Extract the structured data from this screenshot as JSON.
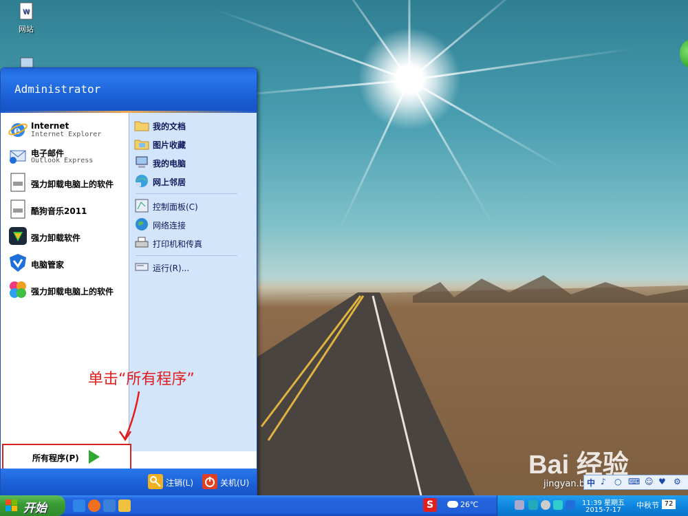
{
  "desktop": {
    "icons": [
      {
        "label": "网站",
        "icon": "html-file-icon"
      },
      {
        "label": "",
        "icon": "computer-icon"
      }
    ]
  },
  "start_menu": {
    "user": "Administrator",
    "pinned": [
      {
        "title": "Internet",
        "subtitle": "Internet Explorer",
        "icon": "ie-icon"
      },
      {
        "title": "电子邮件",
        "subtitle": "Outlook Express",
        "icon": "outlook-icon"
      }
    ],
    "recent": [
      {
        "label": "强力卸载电脑上的软件",
        "icon": "document-icon"
      },
      {
        "label": "酷狗音乐2011",
        "icon": "document-icon"
      },
      {
        "label": "强力卸载软件",
        "icon": "uninstaller-icon"
      },
      {
        "label": "电脑管家",
        "icon": "shield-icon"
      },
      {
        "label": "强力卸载电脑上的软件",
        "icon": "flower-icon"
      }
    ],
    "places": [
      {
        "label": "我的文档",
        "icon": "folder-icon"
      },
      {
        "label": "图片收藏",
        "icon": "pictures-folder-icon"
      },
      {
        "label": "我的电脑",
        "icon": "computer-icon"
      },
      {
        "label": "网上邻居",
        "icon": "network-icon"
      }
    ],
    "system": [
      {
        "label": "控制面板(C)",
        "icon": "control-panel-icon"
      },
      {
        "label": "网络连接",
        "icon": "network-globe-icon"
      },
      {
        "label": "打印机和传真",
        "icon": "printer-icon"
      }
    ],
    "run": {
      "label": "运行(R)...",
      "icon": "run-icon"
    },
    "all_programs": "所有程序(P)",
    "logoff": "注销(L)",
    "shutdown": "关机(U)"
  },
  "annotation": "单击“所有程序”",
  "taskbar": {
    "start_label": "开始",
    "weather": "26℃",
    "time": "11:39 星期五",
    "date": "2015-7-17",
    "festival": "中秋节",
    "festival_count": "72"
  },
  "ime_bar": [
    "中",
    "♪",
    "○",
    "⌨",
    "☺",
    "♥",
    "⚙"
  ],
  "watermark": {
    "logo": "Bai 经验",
    "url": "jingyan.baidu.com"
  },
  "colors": {
    "xp_blue": "#1e64d8",
    "start_green": "#3a9d35",
    "annotation_red": "#e21d1d"
  }
}
